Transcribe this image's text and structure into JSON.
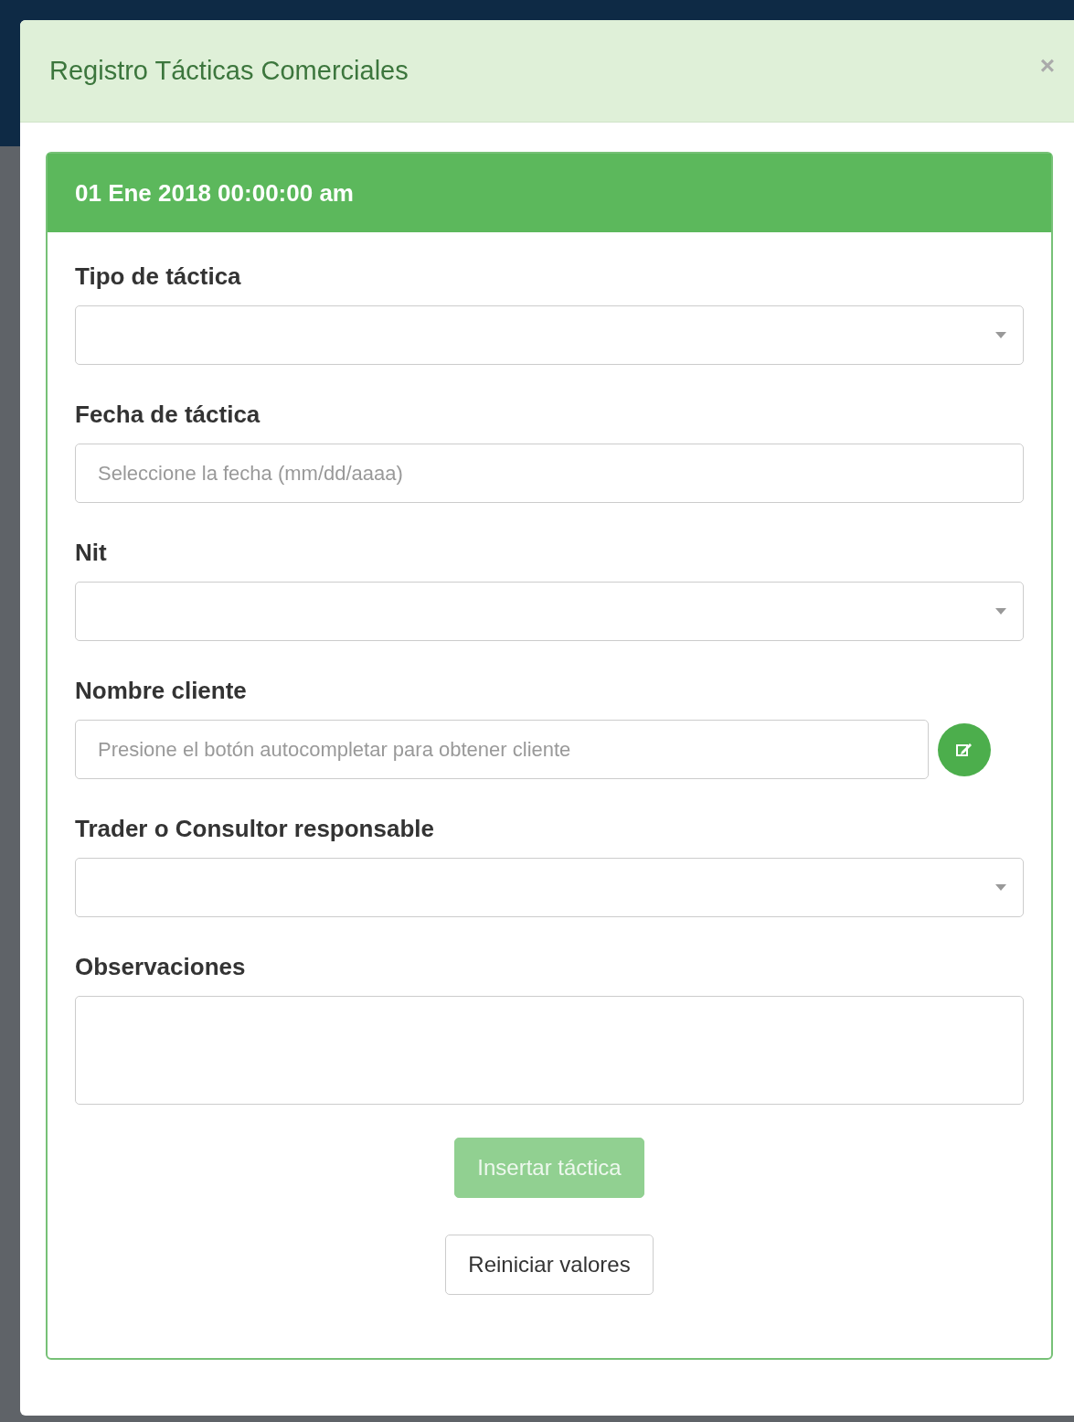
{
  "modal": {
    "title": "Registro Tácticas Comerciales",
    "close": "×"
  },
  "panel": {
    "heading": "01 Ene 2018 00:00:00 am"
  },
  "fields": [
    {
      "kind": "select",
      "label": "Tipo de táctica"
    },
    {
      "kind": "text",
      "label": "Fecha de táctica",
      "placeholder": "Seleccione la fecha (mm/dd/aaaa)"
    },
    {
      "kind": "select",
      "label": "Nit"
    },
    {
      "kind": "autocomplete",
      "label": "Nombre cliente",
      "placeholder": "Presione el botón autocompletar para obtener cliente"
    },
    {
      "kind": "select",
      "label": "Trader o Consultor responsable"
    },
    {
      "kind": "textarea",
      "label": "Observaciones"
    }
  ],
  "buttons": [
    {
      "kind": "primary",
      "label": "Insertar táctica",
      "disabled": true
    },
    {
      "kind": "default",
      "label": "Reiniciar valores",
      "disabled": false
    }
  ]
}
